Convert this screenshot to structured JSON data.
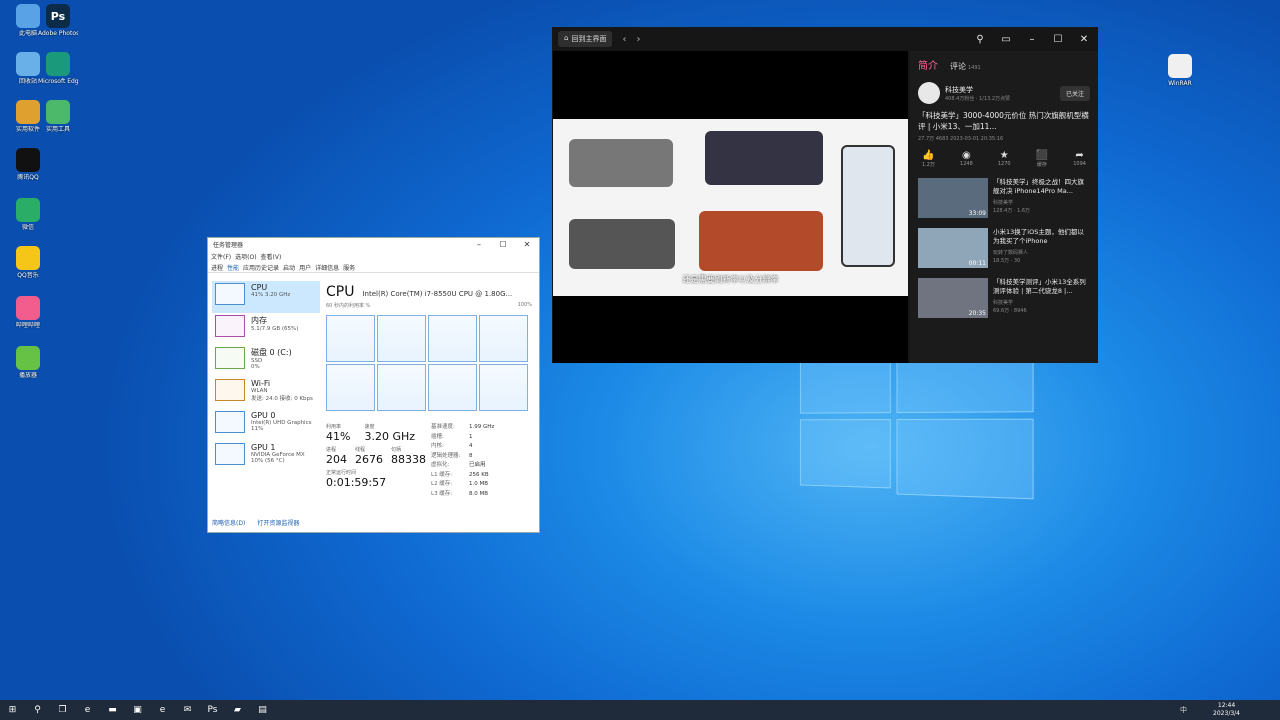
{
  "desktop": {
    "icons": [
      {
        "label": "此电脑",
        "icon": "computer-icon",
        "color": "#5aa2e6"
      },
      {
        "label": "Adobe Photoshop",
        "icon": "photoshop-icon",
        "color": "#0c2b4a",
        "glyph": "Ps"
      },
      {
        "label": "回收站",
        "icon": "recycle-bin-icon",
        "color": "#6ab0e8"
      },
      {
        "label": "Microsoft Edge",
        "icon": "edge-icon",
        "color": "#1a9a7a"
      },
      {
        "label": "实用软件",
        "icon": "folder-icon",
        "color": "#e0a030"
      },
      {
        "label": "实用工具",
        "icon": "tools-icon",
        "color": "#4bb86a"
      },
      {
        "label": "腾讯QQ",
        "icon": "qq-icon",
        "color": "#111111"
      },
      {
        "label": "微信",
        "icon": "wechat-icon",
        "color": "#2aae67"
      },
      {
        "label": "QQ音乐",
        "icon": "qqmusic-icon",
        "color": "#f5c518"
      },
      {
        "label": "哔哩哔哩",
        "icon": "bilibili-icon",
        "color": "#f25d8e"
      },
      {
        "label": "播放器",
        "icon": "player-icon",
        "color": "#66c244"
      },
      {
        "label": "WinRAR",
        "icon": "file-icon",
        "color": "#f0f0f0"
      }
    ]
  },
  "taskmgr": {
    "title": "任务管理器",
    "menu": [
      "文件(F)",
      "选项(O)",
      "查看(V)"
    ],
    "tabs": [
      "进程",
      "性能",
      "应用历史记录",
      "启动",
      "用户",
      "详细信息",
      "服务"
    ],
    "window_controls": [
      "–",
      "☐",
      "✕"
    ],
    "side": [
      {
        "name": "CPU",
        "sub": "41% 3.20 GHz"
      },
      {
        "name": "内存",
        "sub": "5.1/7.9 GB (65%)"
      },
      {
        "name": "磁盘 0 (C:)",
        "sub": "SSD",
        "sub2": "0%"
      },
      {
        "name": "Wi-Fi",
        "sub": "WLAN",
        "sub2": "发送: 24.0 接收: 0 Kbps"
      },
      {
        "name": "GPU 0",
        "sub": "Intel(R) UHD Graphics",
        "sub2": "11%"
      },
      {
        "name": "GPU 1",
        "sub": "NVIDIA GeForce MX",
        "sub2": "10% (56 °C)"
      }
    ],
    "cpu": {
      "title": "CPU",
      "model": "Intel(R) Core(TM) i7-8550U CPU @ 1.80G...",
      "graph_label": "60 秒内的利用率 %",
      "graph_max": "100%",
      "usage_label": "利用率",
      "usage": "41%",
      "speed_label": "速度",
      "speed": "3.20 GHz",
      "proc_label": "进程",
      "processes": "204",
      "thr_label": "线程",
      "threads": "2676",
      "hdl_label": "句柄",
      "handles": "88338",
      "up_label": "正常运行时间",
      "uptime": "0:01:59:57",
      "right": [
        {
          "k": "基准速度:",
          "v": "1.99 GHz"
        },
        {
          "k": "插槽:",
          "v": "1"
        },
        {
          "k": "内核:",
          "v": "4"
        },
        {
          "k": "逻辑处理器:",
          "v": "8"
        },
        {
          "k": "虚拟化:",
          "v": "已启用"
        },
        {
          "k": "L1 缓存:",
          "v": "256 KB"
        },
        {
          "k": "L2 缓存:",
          "v": "1.0 MB"
        },
        {
          "k": "L3 缓存:",
          "v": "8.0 MB"
        }
      ]
    },
    "footer": {
      "fewer": "简略信息(D)",
      "monitor": "打开资源监视器"
    }
  },
  "player": {
    "home": "回到主界面",
    "tabs": {
      "intro": "简介",
      "comments": "评论",
      "count": "1491"
    },
    "uploader": {
      "name": "科技美学",
      "desc": "408.4万粉丝 · 1/13.2万点赞",
      "follow": "已关注"
    },
    "title": "「科技美学」3000-4000元价位 热门次旗舰机型横评 | 小米13、一加11...",
    "expand": "展开",
    "meta": "27.7万  4683  2023-03-01 20:35:16",
    "actions": [
      {
        "icon": "like-icon",
        "glyph": "👍",
        "count": "1.2万"
      },
      {
        "icon": "coin-icon",
        "glyph": "◉",
        "count": "1248"
      },
      {
        "icon": "star-icon",
        "glyph": "★",
        "count": "1270"
      },
      {
        "icon": "favorite-icon",
        "glyph": "⬛",
        "count": "缓存"
      },
      {
        "icon": "share-icon",
        "glyph": "➦",
        "count": "1094"
      }
    ],
    "caption": "还是需要刷新率以及分辨率",
    "recs": [
      {
        "title": "「科技美学」终极之战！四大旗舰对决 iPhone14Pro Ma...",
        "author": "科技美学",
        "stats": "128.4万 · 1.6万",
        "dur": "33:09",
        "color": "#5a6b7d"
      },
      {
        "title": "小米13换了iOS主题，他们都以为我买了个iPhone",
        "author": "玩转了数码狮人",
        "stats": "18.5万 · 30",
        "dur": "00:11",
        "color": "#8fa6b8"
      },
      {
        "title": "「科技美学测评」小米13全系列测评体验 | 第二代骁龙8 |...",
        "author": "科技美学",
        "stats": "69.6万 · 8946",
        "dur": "20:35",
        "color": "#6f7480"
      }
    ]
  },
  "taskbar": {
    "apps": [
      "start-icon",
      "search-icon",
      "taskview-icon",
      "edge-icon",
      "explorer-icon",
      "store-icon",
      "edge-icon",
      "wechat-icon",
      "photoshop-icon",
      "bilibili-icon",
      "taskmgr-icon"
    ],
    "time": "12:44",
    "date": "2023/3/4",
    "ime": "中"
  }
}
